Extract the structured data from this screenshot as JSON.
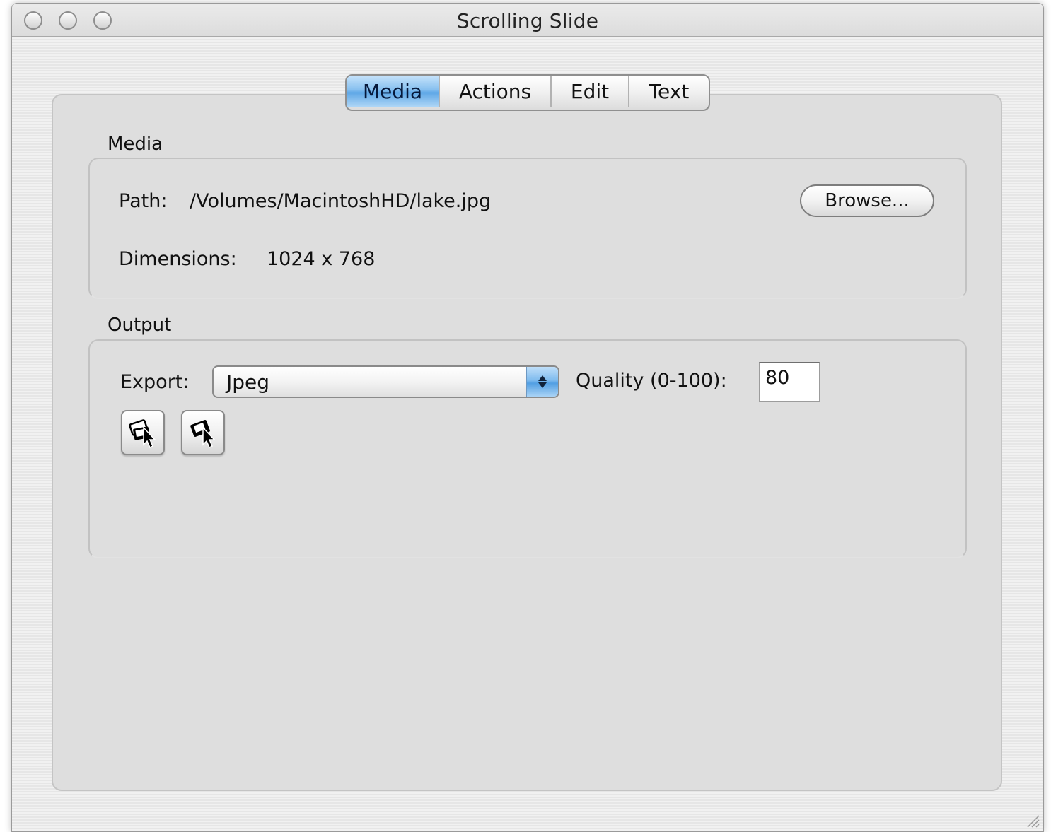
{
  "window": {
    "title": "Scrolling Slide"
  },
  "tabs": [
    {
      "label": "Media",
      "selected": true
    },
    {
      "label": "Actions",
      "selected": false
    },
    {
      "label": "Edit",
      "selected": false
    },
    {
      "label": "Text",
      "selected": false
    }
  ],
  "media_group": {
    "title": "Media",
    "path_label": "Path:",
    "path_value": "/Volumes/MacintoshHD/lake.jpg",
    "browse_label": "Browse...",
    "dimensions_label": "Dimensions:",
    "dimensions_value": "1024 x 768"
  },
  "output_group": {
    "title": "Output",
    "export_label": "Export:",
    "export_value": "Jpeg",
    "quality_label": "Quality (0-100):",
    "quality_value": "80",
    "icon_buttons": [
      "select-pointer-icon",
      "drag-pointer-icon"
    ]
  },
  "colors": {
    "accent_tab": "#6aa9e6",
    "panel": "#dedede",
    "window": "#ececec"
  }
}
